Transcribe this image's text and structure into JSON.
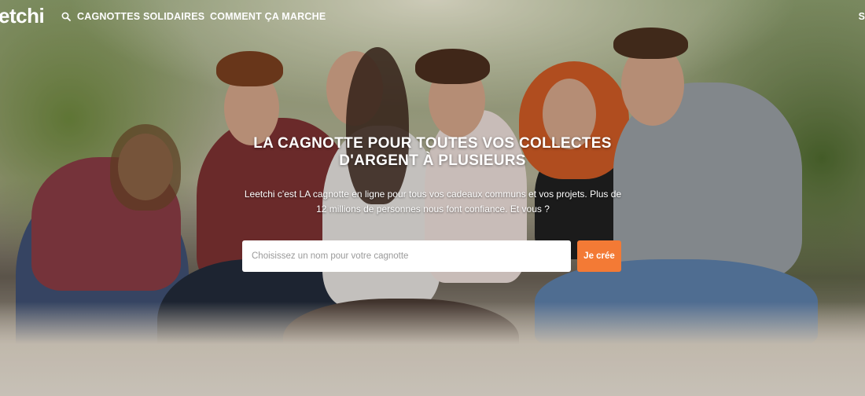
{
  "nav": {
    "logo": "etchi",
    "search_label": "CAGNOTTES SOLIDAIRES",
    "how_label": "COMMENT ÇA MARCHE",
    "edge_label": "S"
  },
  "hero": {
    "title_line1": "LA CAGNOTTE POUR TOUTES VOS COLLECTES",
    "title_line2": "D'ARGENT À PLUSIEURS",
    "subtitle_line1": "Leetchi c'est LA cagnotte en ligne pour tous vos cadeaux communs et vos projets. Plus de",
    "subtitle_line2": "12 millions de personnes nous font confiance. Et vous ?",
    "input_value": "",
    "input_placeholder": "Choisissez un nom pour votre cagnotte",
    "button_label": "Je crée"
  },
  "colors": {
    "accent": "#f37a35",
    "nav_text": "#ffffff"
  },
  "icons": {
    "search": "search-icon"
  }
}
